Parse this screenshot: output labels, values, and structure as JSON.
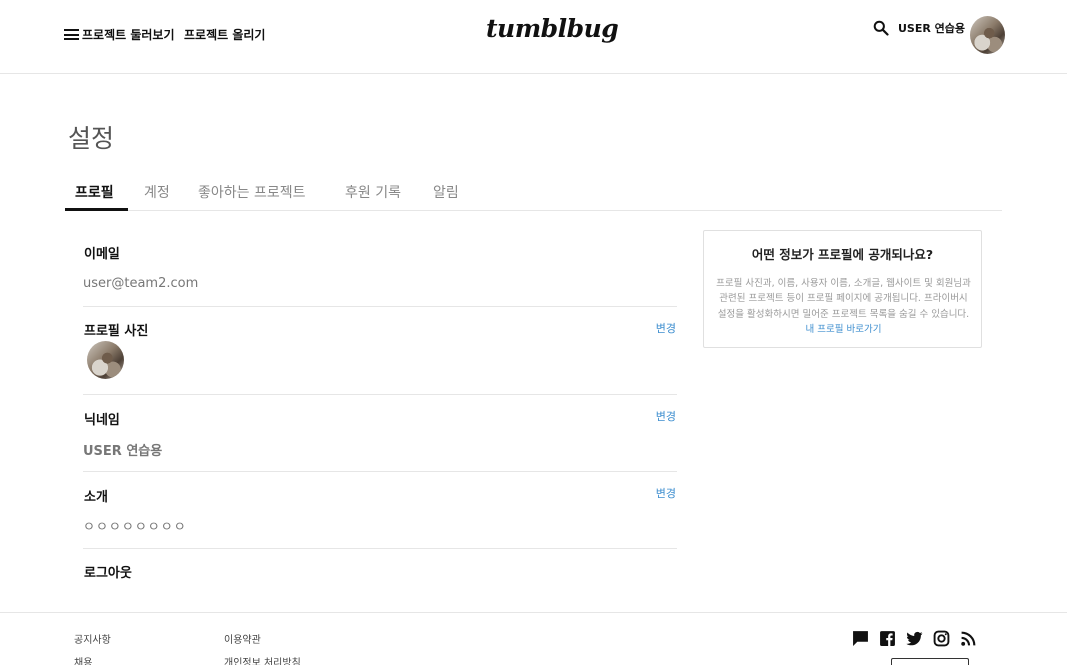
{
  "header": {
    "nav": [
      "프로젝트 둘러보기",
      "프로젝트 올리기"
    ],
    "logo": "tumblbug",
    "user_label": "USER 연습용"
  },
  "page": {
    "title": "설정",
    "tabs": [
      "프로필",
      "계정",
      "좋아하는 프로젝트",
      "후원 기록",
      "알림"
    ],
    "active_tab": "프로필"
  },
  "sections": {
    "email": {
      "label": "이메일",
      "value": "user@team2.com"
    },
    "photo": {
      "label": "프로필 사진",
      "change": "변경"
    },
    "nickname": {
      "label": "닉네임",
      "value": "USER 연습용",
      "change": "변경"
    },
    "intro": {
      "label": "소개",
      "value": "ㅇㅇㅇㅇㅇㅇㅇㅇ",
      "change": "변경"
    },
    "logout": {
      "label": "로그아웃"
    }
  },
  "info_box": {
    "title": "어떤 정보가 프로필에 공개되나요?",
    "body": "프로필 사진과, 이름, 사용자 이름, 소개글, 웹사이트 및 회원님과 관련된 프로젝트 등이 프로필 페이지에 공개됩니다. 프라이버시 설정을 활성화하시면 밀어준 프로젝트 목록을 숨길 수 있습니다.",
    "link": "내 프로필 바로가기"
  },
  "footer": {
    "col1": [
      "공지사항",
      "채용"
    ],
    "col2": [
      "이용약관",
      "개인정보 처리방침"
    ],
    "social_icons": [
      "chat-icon",
      "facebook-icon",
      "twitter-icon",
      "instagram-icon",
      "rss-icon"
    ]
  },
  "colors": {
    "accent": "#3d8ecf",
    "text": "#111111",
    "muted": "#777777",
    "border": "#e6e6e6"
  }
}
